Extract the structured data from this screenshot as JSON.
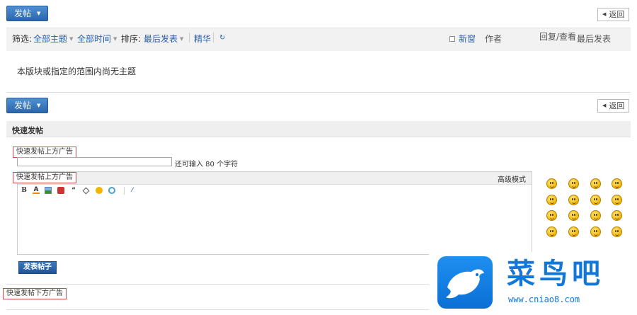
{
  "top": {
    "post_button": "发帖",
    "back_button": "返回"
  },
  "filter": {
    "label": "筛选:",
    "all_topics": "全部主题",
    "all_time": "全部时间",
    "sort_label": "排序:",
    "sort_value": "最后发表",
    "digest": "精华",
    "new_window": "新窗",
    "col_author": "作者",
    "col_replies": "回复/查看",
    "col_last_post": "最后发表"
  },
  "empty_message": "本版块或指定的范围内尚无主题",
  "bottom_bar": {
    "post_button": "发帖",
    "back_button": "返回"
  },
  "quick_post": {
    "title": "快速发帖",
    "ad_top": "快速发帖上方广告",
    "title_hint": "还可输入 80 个字符",
    "ad_editor": "快速发帖上方广告",
    "advanced_mode": "高级模式",
    "toolbar": [
      "B",
      "A",
      "image",
      "flash",
      "quote",
      "code",
      "smilies",
      "find",
      "attach"
    ],
    "submit": "发表帖子",
    "ad_bottom": "快速发帖下方广告"
  },
  "smilies_count": 16,
  "watermark": {
    "name": "菜鸟吧",
    "url": "www.cniao8.com"
  }
}
